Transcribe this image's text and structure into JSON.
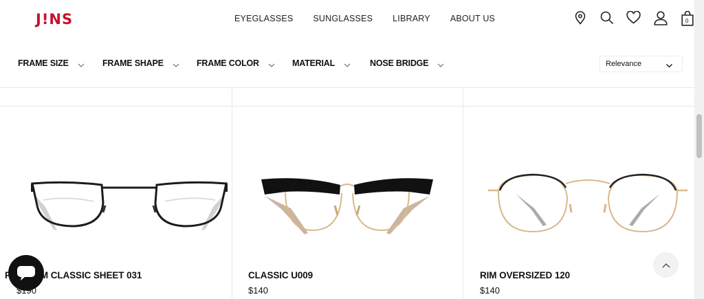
{
  "brand": {
    "logo_text": "J!NS",
    "logo_color": "#c8102e"
  },
  "nav": {
    "items": [
      "EYEGLASSES",
      "SUNGLASSES",
      "LIBRARY",
      "ABOUT US"
    ]
  },
  "header_icons": [
    "location-pin-icon",
    "search-icon",
    "heart-icon",
    "user-icon",
    "shopping-bag-icon"
  ],
  "cart": {
    "count": "0"
  },
  "filters": [
    {
      "label": "FRAME SIZE"
    },
    {
      "label": "FRAME SHAPE"
    },
    {
      "label": "FRAME COLOR"
    },
    {
      "label": "MATERIAL"
    },
    {
      "label": "NOSE BRIDGE"
    }
  ],
  "sort": {
    "selected": "Relevance"
  },
  "products": [
    {
      "name": "PREMIUM CLASSIC SHEET 031",
      "price": "$190"
    },
    {
      "name": "CLASSIC U009",
      "price": "$140"
    },
    {
      "name": "RIM OVERSIZED 120",
      "price": "$140"
    }
  ],
  "floating": {
    "chat_icon": "chat-bubble-icon",
    "top_icon": "chevron-up-icon"
  }
}
